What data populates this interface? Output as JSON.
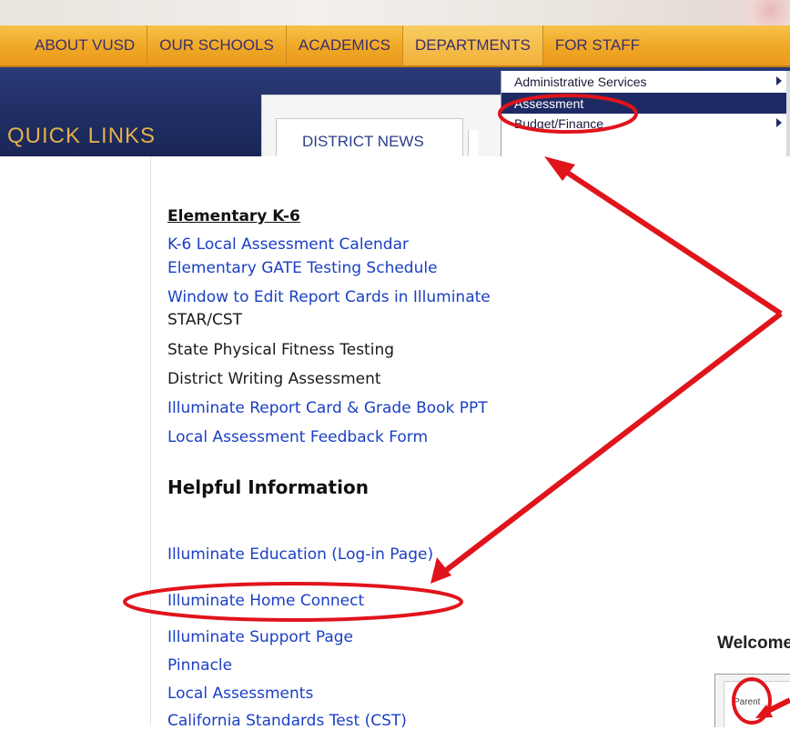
{
  "nav": {
    "items": [
      "ABOUT VUSD",
      "OUR SCHOOLS",
      "ACADEMICS",
      "DEPARTMENTS",
      "FOR STAFF"
    ]
  },
  "sidebar": {
    "quick_links": "QUICK LINKS"
  },
  "tabs": {
    "district_news": "DISTRICT NEWS"
  },
  "dropdown": {
    "items": [
      {
        "label": "Administrative Services",
        "has_submenu": true
      },
      {
        "label": "Assessment",
        "selected": true
      },
      {
        "label": "Budget/Finance",
        "has_submenu": true
      }
    ]
  },
  "elementary": {
    "heading": "Elementary K-6",
    "items": [
      {
        "label": "K-6 Local Assessment Calendar",
        "link": true
      },
      {
        "label": "Elementary GATE Testing Schedule",
        "link": true
      },
      {
        "label": "Window to Edit Report Cards in Illuminate",
        "link": true
      },
      {
        "label": "STAR/CST",
        "link": false
      },
      {
        "label": "State Physical Fitness Testing",
        "link": false
      },
      {
        "label": "District Writing Assessment",
        "link": false
      },
      {
        "label": "Illuminate Report Card & Grade Book PPT",
        "link": true
      },
      {
        "label": "Local Assessment Feedback Form",
        "link": true
      }
    ]
  },
  "helpful": {
    "heading": "Helpful Information",
    "items": [
      {
        "label": "Illuminate Education (Log-in Page)"
      },
      {
        "label": "Illuminate Home Connect"
      },
      {
        "label": "Illuminate Support Page"
      },
      {
        "label": "Pinnacle"
      },
      {
        "label": "Local Assessments"
      },
      {
        "label": "California Standards Test (CST)"
      }
    ]
  },
  "welcome": {
    "text": "Welcome"
  },
  "mini_tab": {
    "label": "Parent"
  },
  "colors": {
    "nav_orange": "#f0a726",
    "nav_text": "#3b2f6a",
    "brand_navy": "#1f2d63",
    "link_blue": "#1a3fc4",
    "annotation_red": "#e0141b"
  }
}
